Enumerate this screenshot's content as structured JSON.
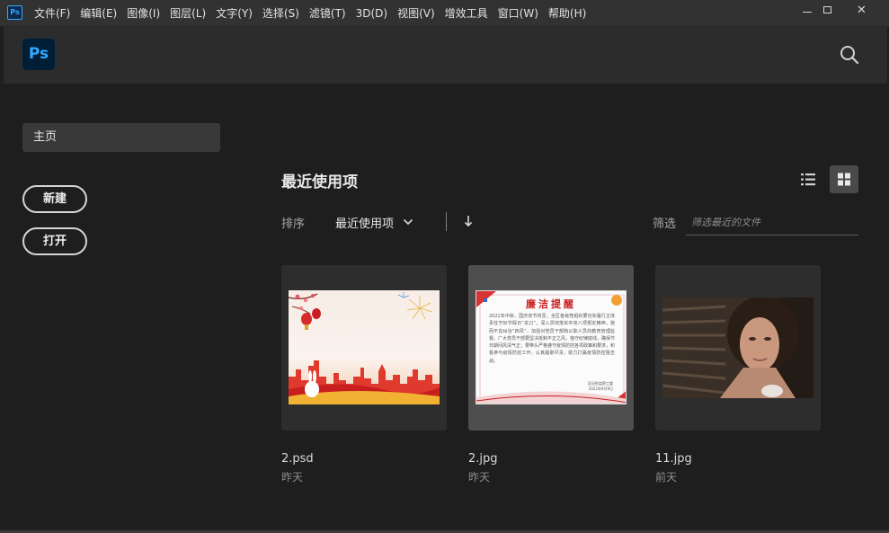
{
  "app": {
    "icon_label": "Ps",
    "logo_label": "Ps"
  },
  "menu": {
    "items": [
      "文件(F)",
      "编辑(E)",
      "图像(I)",
      "图层(L)",
      "文字(Y)",
      "选择(S)",
      "滤镜(T)",
      "3D(D)",
      "视图(V)",
      "增效工具",
      "窗口(W)",
      "帮助(H)"
    ]
  },
  "window_controls": {
    "close_glyph": "✕"
  },
  "sidebar": {
    "home_label": "主页",
    "new_label": "新建",
    "open_label": "打开"
  },
  "main": {
    "section_title": "最近使用项",
    "sort_label": "排序",
    "sort_value": "最近使用项",
    "filter_label": "筛选",
    "filter_placeholder": "筛选最近的文件"
  },
  "recent_files": [
    {
      "name": "2.psd",
      "date": "昨天",
      "selected": false
    },
    {
      "name": "2.jpg",
      "date": "昨天",
      "selected": true
    },
    {
      "name": "11.jpg",
      "date": "前天",
      "selected": false
    }
  ],
  "thumbnail_doc": {
    "title": "廉洁提醒",
    "body": "2022年中秋、国庆双节将至，全区各级党组织要切实履行主体责任守好节假日“关口”，深入贯彻落实中央八项规定精神，驰而不息纠治“四风”，加强对党员干部和公职人员的教育管理监督。广大党员干部要坚决抵制不正之风，恪守纪律底线，确保节日期间风清气正；要带头严格遵守疫情防控各项政策和要求，积极参与疫情防控工作，认真履职尽责，助力打赢疫情防控阻击战。",
    "signature": "区纪检监察工委",
    "sign_date": "2022年9月9日"
  },
  "colors": {
    "accent": "#31a8ff",
    "background": "#1e1e1e",
    "header": "#2c2c2c",
    "menubar": "#323232",
    "selected_card": "#4e4e4e"
  },
  "icons": {
    "search": "search-icon",
    "list_view": "list-view-icon",
    "grid_view": "grid-view-icon",
    "sort_direction": "arrow-down-icon",
    "dropdown": "chevron-down-icon"
  }
}
